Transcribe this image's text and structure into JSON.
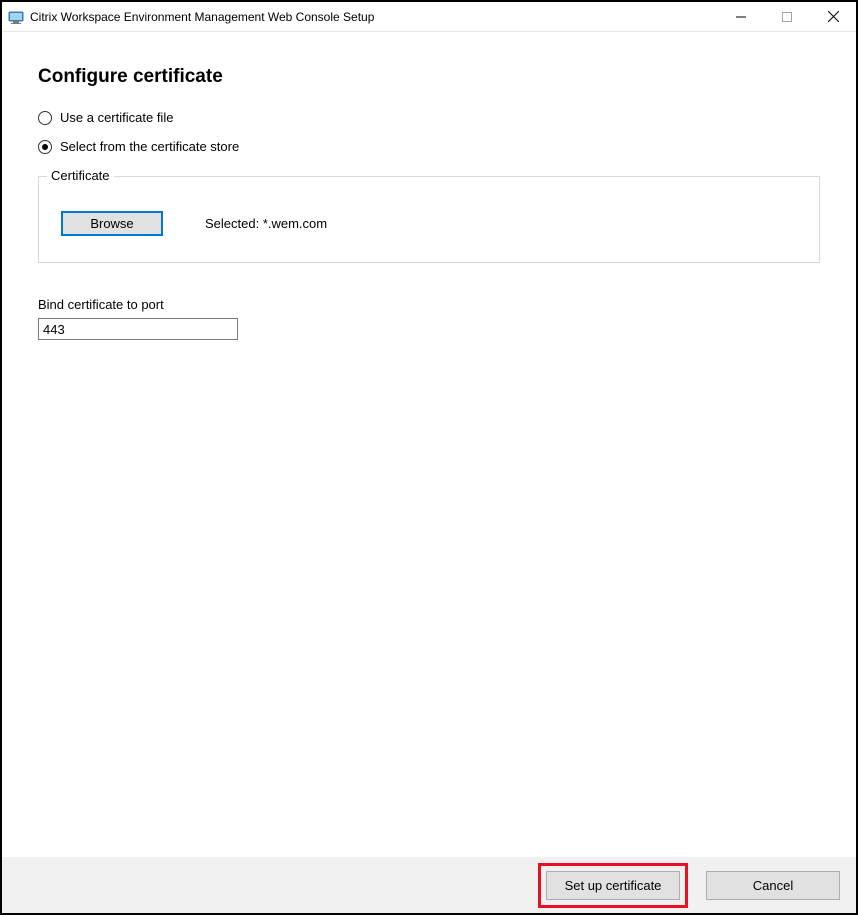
{
  "window": {
    "title": "Citrix Workspace Environment Management Web Console Setup"
  },
  "page": {
    "heading": "Configure certificate",
    "radio": {
      "file_label": "Use a certificate file",
      "store_label": "Select from the certificate store"
    },
    "certificate": {
      "legend": "Certificate",
      "browse_label": "Browse",
      "selected_text": "Selected: *.wem.com"
    },
    "port": {
      "label": "Bind certificate to port",
      "value": "443"
    }
  },
  "footer": {
    "setup_label": "Set up certificate",
    "cancel_label": "Cancel"
  }
}
